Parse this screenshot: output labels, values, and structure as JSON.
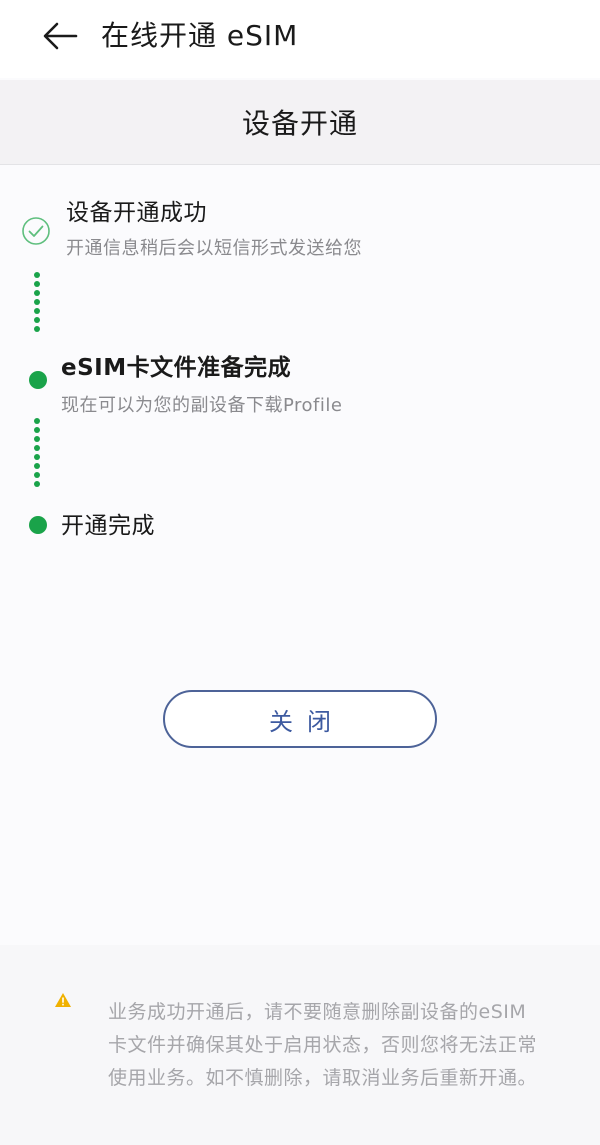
{
  "header": {
    "title": "在线开通 eSIM"
  },
  "section": {
    "title": "设备开通"
  },
  "steps": [
    {
      "title": "设备开通成功",
      "description": "开通信息稍后会以短信形式发送给您",
      "status": "completed-check"
    },
    {
      "title": "eSIM卡文件准备完成",
      "description": "现在可以为您的副设备下载Profile",
      "status": "completed-dot"
    },
    {
      "title": "开通完成",
      "description": "",
      "status": "completed-dot"
    }
  ],
  "close_button": {
    "label": "关闭"
  },
  "notice": {
    "text": "业务成功开通后，请不要随意删除副设备的eSIM 卡文件并确保其处于启用状态，否则您将无法正常使用业务。如不慎删除，请取消业务后重新开通。"
  },
  "colors": {
    "step_green": "#1aa34a",
    "button_border": "#4d6398",
    "warning": "#f0b100"
  }
}
